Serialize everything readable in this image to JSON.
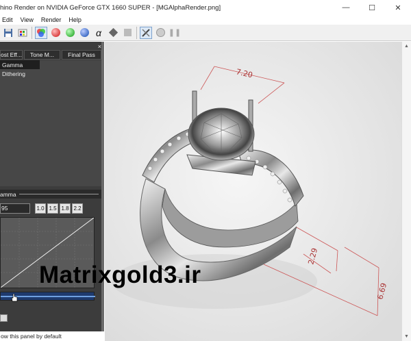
{
  "window": {
    "title": "hino Render on NVIDIA GeForce GTX 1660 SUPER - [MGAlphaRender.png]",
    "minimize": "—",
    "maximize": "☐",
    "close": "✕"
  },
  "menu": [
    "Edit",
    "View",
    "Render",
    "Help"
  ],
  "toolbar_icons": [
    "save-icon",
    "export-icon",
    "rgb-channels-icon",
    "red-channel-icon",
    "green-channel-icon",
    "blue-channel-icon",
    "alpha-icon",
    "cube-icon",
    "cube-gray-icon",
    "settings-tools-icon",
    "render-icon",
    "pause-icon"
  ],
  "panel": {
    "close": "×",
    "tabs": [
      "ost Eff...",
      "Tone M...",
      "Final Pass"
    ],
    "effects": [
      "Gamma",
      "Dithering"
    ],
    "gamma_title": "amma",
    "gamma_value": "95",
    "gamma_presets": [
      "1.0",
      "1.5",
      "1.8",
      "2.2"
    ],
    "footer": "ow this panel by default"
  },
  "viewport": {
    "dimensions": [
      "7.20",
      "2.29",
      "6.69"
    ],
    "watermark": "Matrixgold3.ir"
  }
}
